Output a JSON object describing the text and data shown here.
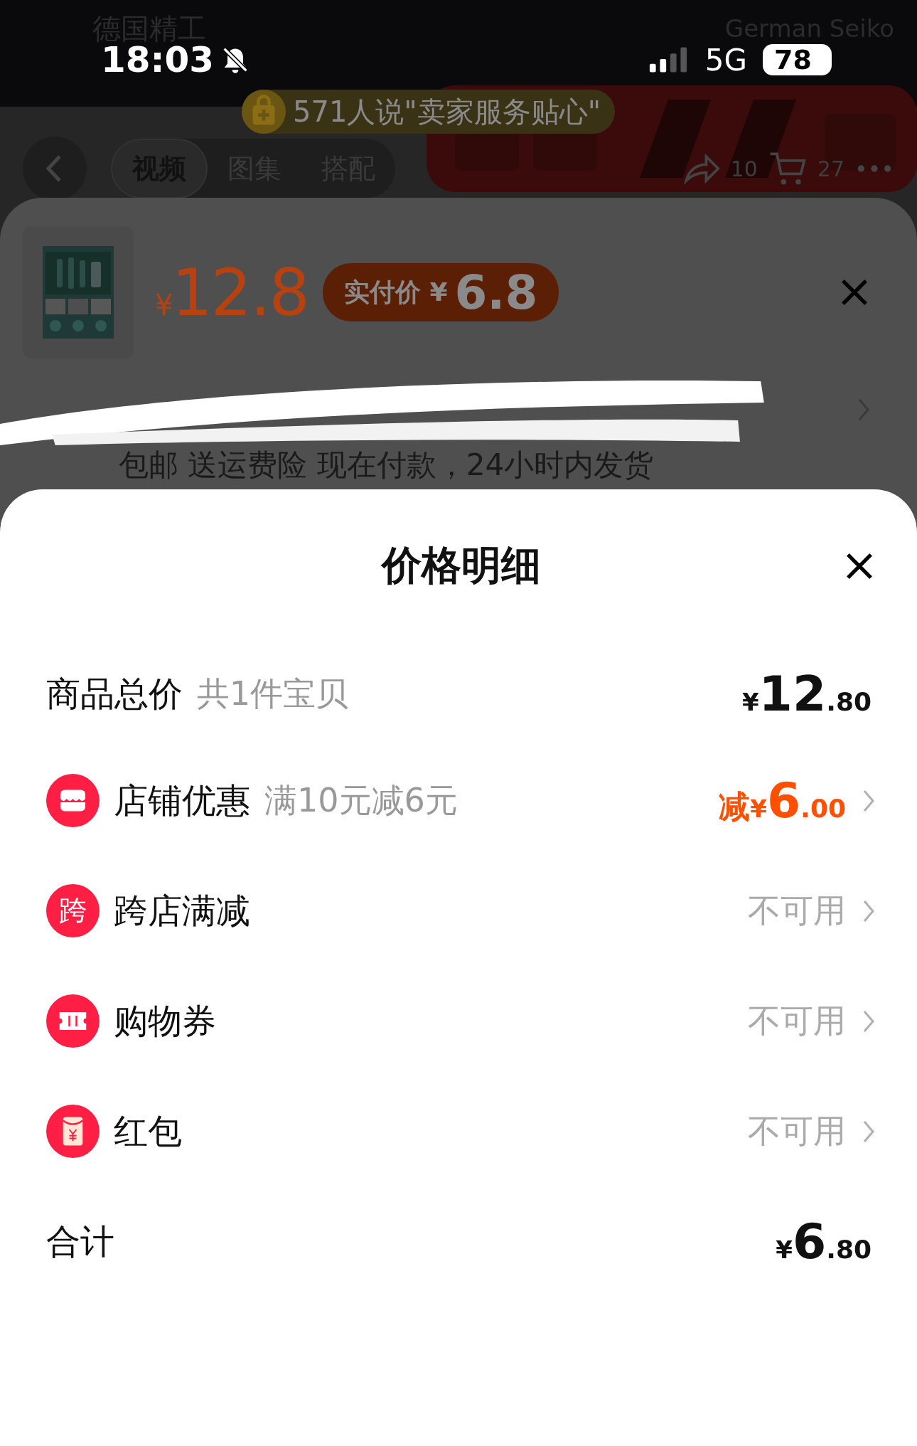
{
  "status_bar": {
    "time": "18:03",
    "network": "5G",
    "battery": "78"
  },
  "background": {
    "shop_name": "德国精工",
    "shop_name_en": "German Seiko",
    "badge": "571人说\"卖家服务贴心\"",
    "tabs": [
      {
        "label": "视频",
        "selected": true
      },
      {
        "label": "图集",
        "selected": false
      },
      {
        "label": "搭配",
        "selected": false
      }
    ],
    "counts": [
      "10",
      "27"
    ]
  },
  "product_sheet": {
    "price_symbol": "¥",
    "price": "12.8",
    "paid_label": "实付价",
    "paid_symbol": "¥",
    "paid_price": "6.8",
    "delivery": "包邮 送运费险 现在付款，24小时内发货"
  },
  "price_detail": {
    "title": "价格明细",
    "rows": [
      {
        "kind": "price",
        "label": "商品总价",
        "note": "共1件宝贝",
        "amount": {
          "symbol": "¥",
          "integer": "12",
          "decimal": ".80"
        }
      },
      {
        "kind": "discount",
        "label": "店铺优惠",
        "note": "满10元减6元",
        "amount": {
          "prefix": "减",
          "symbol": "¥",
          "integer": "6",
          "decimal": ".00"
        }
      },
      {
        "kind": "unavailable",
        "icon_text": "跨",
        "label": "跨店满减",
        "status": "不可用"
      },
      {
        "kind": "unavailable",
        "label": "购物券",
        "status": "不可用"
      },
      {
        "kind": "unavailable",
        "label": "红包",
        "status": "不可用"
      },
      {
        "kind": "total",
        "label": "合计",
        "amount": {
          "symbol": "¥",
          "integer": "6",
          "decimal": ".80"
        }
      }
    ]
  }
}
